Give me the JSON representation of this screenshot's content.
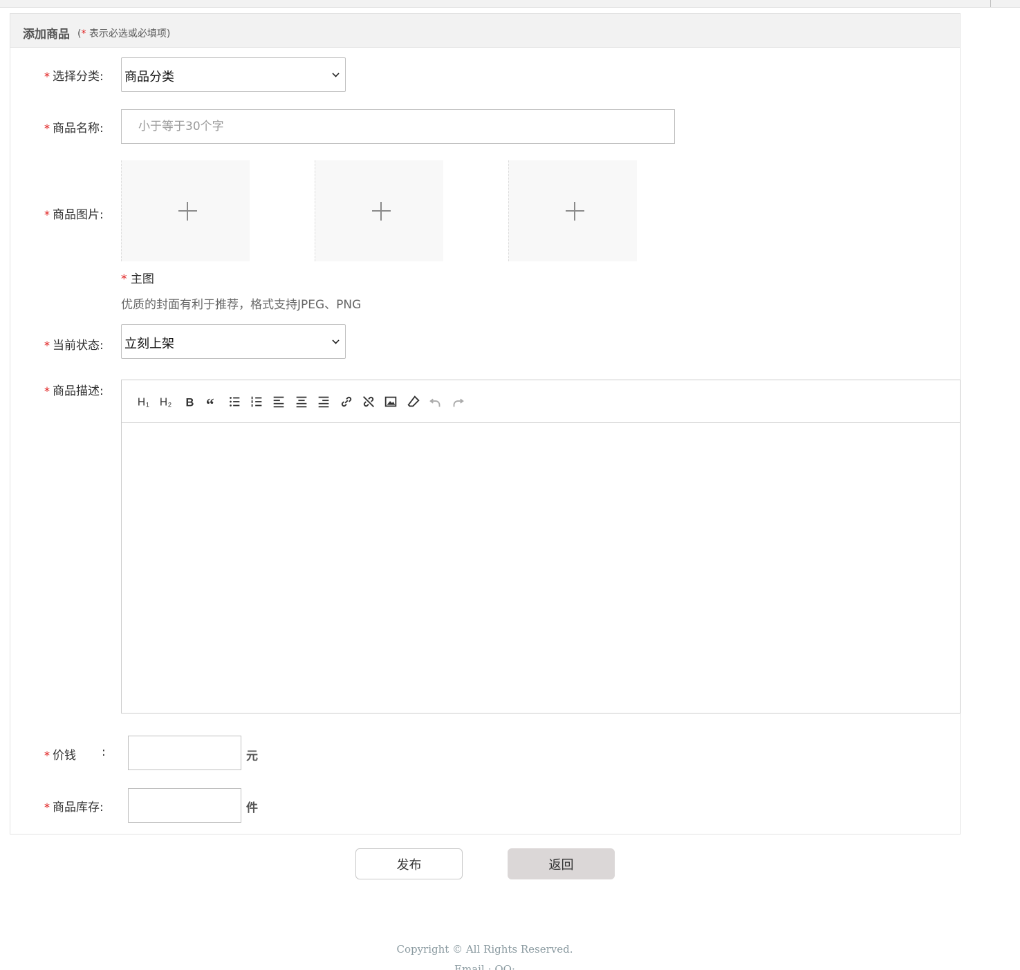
{
  "panel": {
    "title": "添加商品",
    "hint_open": "(",
    "hint_star": "*",
    "hint_text": " 表示必选或必填项)"
  },
  "form": {
    "category": {
      "label": "选择分类:",
      "value": "商品分类"
    },
    "name": {
      "label": "商品名称:",
      "placeholder": "小于等于30个字"
    },
    "images": {
      "label": "商品图片:",
      "main_label": "主图",
      "note": "优质的封面有利于推荐，格式支持JPEG、PNG",
      "slots": 3
    },
    "status": {
      "label": "当前状态:",
      "value": "立刻上架"
    },
    "description": {
      "label": "商品描述:",
      "toolbar": [
        "heading1-icon",
        "heading2-icon",
        "bold-icon",
        "quote-icon",
        "bullet-list-icon",
        "ordered-list-icon",
        "align-left-icon",
        "align-center-icon",
        "align-right-icon",
        "link-icon",
        "unlink-icon",
        "image-icon",
        "eraser-icon",
        "undo-icon",
        "redo-icon"
      ]
    },
    "price": {
      "label": "价钱",
      "colon": ":",
      "value": "",
      "unit": "元"
    },
    "stock": {
      "label": "商品库存:",
      "value": "",
      "unit": "件"
    }
  },
  "actions": {
    "publish": "发布",
    "back": "返回"
  },
  "footer": {
    "copyright": "Copyright © All Rights Reserved.",
    "contact": "Email : QQ:"
  },
  "colors": {
    "required": "#e02020",
    "back_button_bg": "#dbd7d7",
    "footer_text": "#8a9aa0"
  }
}
